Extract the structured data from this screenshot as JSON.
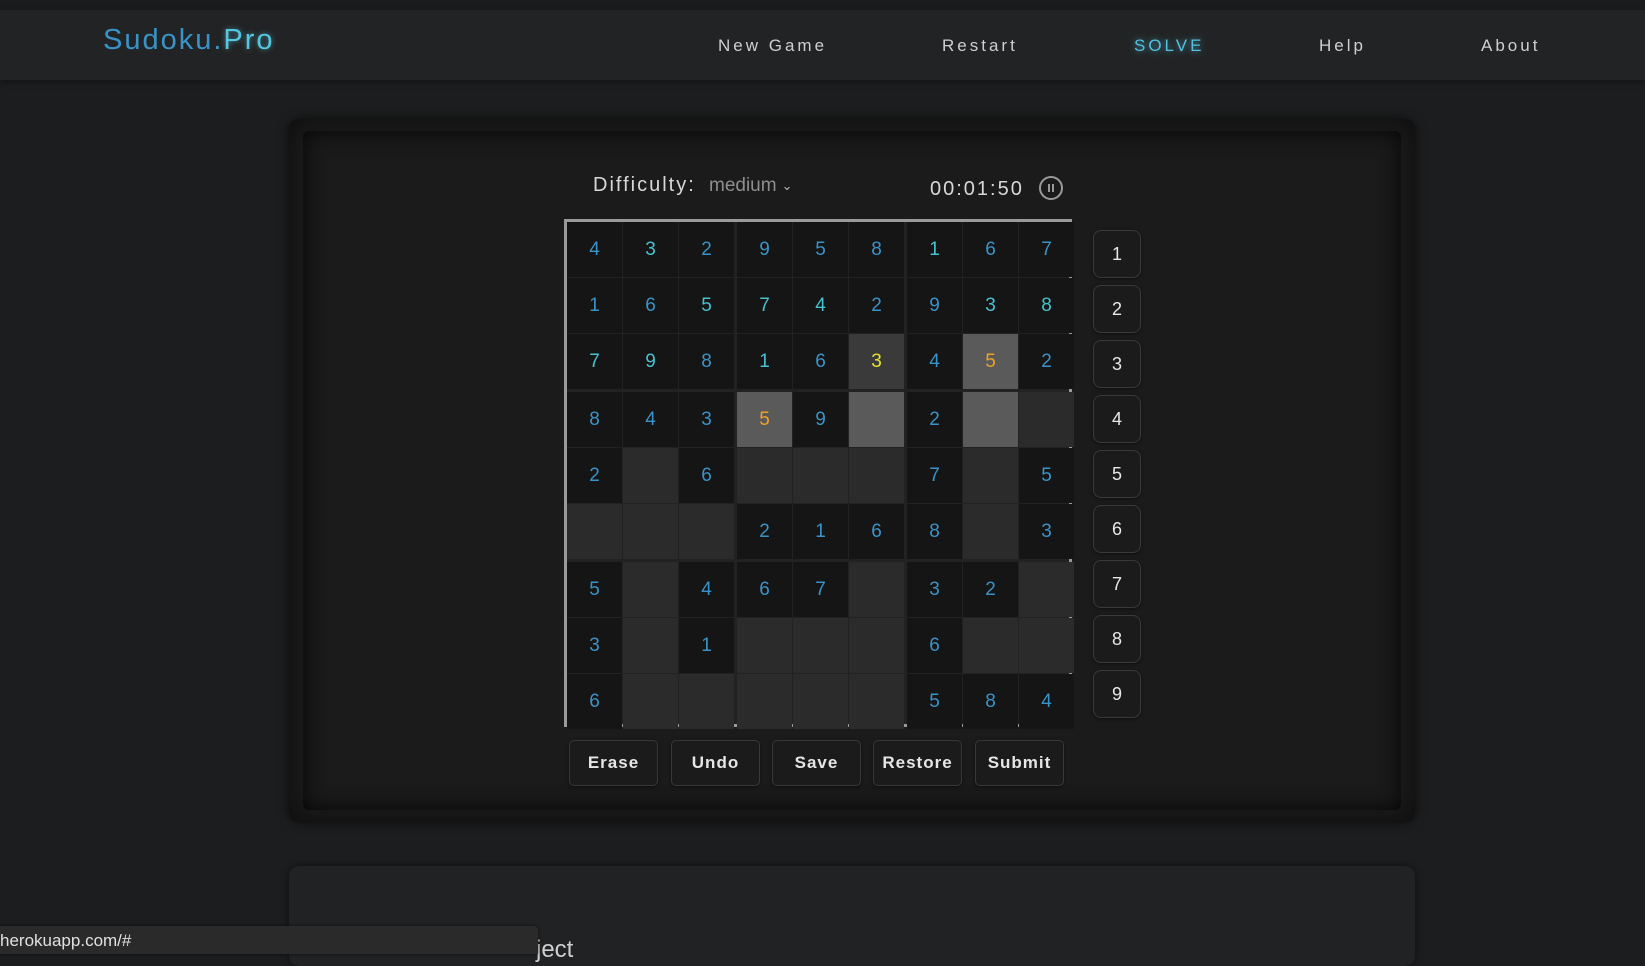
{
  "brand": {
    "part1": "Sudoku.",
    "part2": "Pro"
  },
  "nav": {
    "new_game": "New Game",
    "restart": "Restart",
    "solve": "SOLVE",
    "help": "Help",
    "about": "About"
  },
  "difficulty": {
    "label": "Difficulty:",
    "value": "medium"
  },
  "timer": {
    "value": "00:01:50"
  },
  "board": {
    "rows": [
      [
        "4",
        "3",
        "2",
        "9",
        "5",
        "8",
        "1",
        "6",
        "7"
      ],
      [
        "1",
        "6",
        "5",
        "7",
        "4",
        "2",
        "9",
        "3",
        "8"
      ],
      [
        "7",
        "9",
        "8",
        "1",
        "6",
        "3",
        "4",
        "5",
        "2"
      ],
      [
        "8",
        "4",
        "3",
        "5",
        "9",
        "",
        "2",
        "",
        ""
      ],
      [
        "2",
        "",
        "6",
        "",
        "",
        "",
        "7",
        "",
        "5"
      ],
      [
        "",
        "",
        "",
        "2",
        "1",
        "6",
        "8",
        "",
        "3"
      ],
      [
        "5",
        "",
        "4",
        "6",
        "7",
        "",
        "3",
        "2",
        ""
      ],
      [
        "3",
        "",
        "1",
        "",
        "",
        "",
        "6",
        "",
        ""
      ],
      [
        "6",
        "",
        "",
        "",
        "",
        "",
        "5",
        "8",
        "4"
      ]
    ],
    "highlight_colors": {
      "given": "#3a93c8",
      "entered": "#48c2cf",
      "selected_value": "#e6e12e",
      "conflict": "#eda128"
    }
  },
  "numpad": [
    "1",
    "2",
    "3",
    "4",
    "5",
    "6",
    "7",
    "8",
    "9"
  ],
  "actions": {
    "erase": "Erase",
    "undo": "Undo",
    "save": "Save",
    "restore": "Restore",
    "submit": "Submit"
  },
  "partial_heading": "ject",
  "status_url": "herokuapp.com/#"
}
